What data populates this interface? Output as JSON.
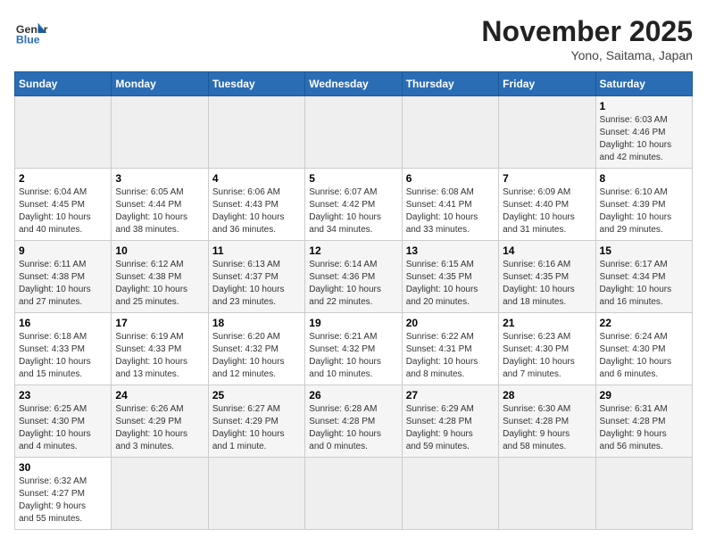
{
  "header": {
    "logo_general": "General",
    "logo_blue": "Blue",
    "month_title": "November 2025",
    "location": "Yono, Saitama, Japan"
  },
  "weekdays": [
    "Sunday",
    "Monday",
    "Tuesday",
    "Wednesday",
    "Thursday",
    "Friday",
    "Saturday"
  ],
  "weeks": [
    [
      {
        "day": "",
        "info": ""
      },
      {
        "day": "",
        "info": ""
      },
      {
        "day": "",
        "info": ""
      },
      {
        "day": "",
        "info": ""
      },
      {
        "day": "",
        "info": ""
      },
      {
        "day": "",
        "info": ""
      },
      {
        "day": "1",
        "info": "Sunrise: 6:03 AM\nSunset: 4:46 PM\nDaylight: 10 hours\nand 42 minutes."
      }
    ],
    [
      {
        "day": "2",
        "info": "Sunrise: 6:04 AM\nSunset: 4:45 PM\nDaylight: 10 hours\nand 40 minutes."
      },
      {
        "day": "3",
        "info": "Sunrise: 6:05 AM\nSunset: 4:44 PM\nDaylight: 10 hours\nand 38 minutes."
      },
      {
        "day": "4",
        "info": "Sunrise: 6:06 AM\nSunset: 4:43 PM\nDaylight: 10 hours\nand 36 minutes."
      },
      {
        "day": "5",
        "info": "Sunrise: 6:07 AM\nSunset: 4:42 PM\nDaylight: 10 hours\nand 34 minutes."
      },
      {
        "day": "6",
        "info": "Sunrise: 6:08 AM\nSunset: 4:41 PM\nDaylight: 10 hours\nand 33 minutes."
      },
      {
        "day": "7",
        "info": "Sunrise: 6:09 AM\nSunset: 4:40 PM\nDaylight: 10 hours\nand 31 minutes."
      },
      {
        "day": "8",
        "info": "Sunrise: 6:10 AM\nSunset: 4:39 PM\nDaylight: 10 hours\nand 29 minutes."
      }
    ],
    [
      {
        "day": "9",
        "info": "Sunrise: 6:11 AM\nSunset: 4:38 PM\nDaylight: 10 hours\nand 27 minutes."
      },
      {
        "day": "10",
        "info": "Sunrise: 6:12 AM\nSunset: 4:38 PM\nDaylight: 10 hours\nand 25 minutes."
      },
      {
        "day": "11",
        "info": "Sunrise: 6:13 AM\nSunset: 4:37 PM\nDaylight: 10 hours\nand 23 minutes."
      },
      {
        "day": "12",
        "info": "Sunrise: 6:14 AM\nSunset: 4:36 PM\nDaylight: 10 hours\nand 22 minutes."
      },
      {
        "day": "13",
        "info": "Sunrise: 6:15 AM\nSunset: 4:35 PM\nDaylight: 10 hours\nand 20 minutes."
      },
      {
        "day": "14",
        "info": "Sunrise: 6:16 AM\nSunset: 4:35 PM\nDaylight: 10 hours\nand 18 minutes."
      },
      {
        "day": "15",
        "info": "Sunrise: 6:17 AM\nSunset: 4:34 PM\nDaylight: 10 hours\nand 16 minutes."
      }
    ],
    [
      {
        "day": "16",
        "info": "Sunrise: 6:18 AM\nSunset: 4:33 PM\nDaylight: 10 hours\nand 15 minutes."
      },
      {
        "day": "17",
        "info": "Sunrise: 6:19 AM\nSunset: 4:33 PM\nDaylight: 10 hours\nand 13 minutes."
      },
      {
        "day": "18",
        "info": "Sunrise: 6:20 AM\nSunset: 4:32 PM\nDaylight: 10 hours\nand 12 minutes."
      },
      {
        "day": "19",
        "info": "Sunrise: 6:21 AM\nSunset: 4:32 PM\nDaylight: 10 hours\nand 10 minutes."
      },
      {
        "day": "20",
        "info": "Sunrise: 6:22 AM\nSunset: 4:31 PM\nDaylight: 10 hours\nand 8 minutes."
      },
      {
        "day": "21",
        "info": "Sunrise: 6:23 AM\nSunset: 4:30 PM\nDaylight: 10 hours\nand 7 minutes."
      },
      {
        "day": "22",
        "info": "Sunrise: 6:24 AM\nSunset: 4:30 PM\nDaylight: 10 hours\nand 6 minutes."
      }
    ],
    [
      {
        "day": "23",
        "info": "Sunrise: 6:25 AM\nSunset: 4:30 PM\nDaylight: 10 hours\nand 4 minutes."
      },
      {
        "day": "24",
        "info": "Sunrise: 6:26 AM\nSunset: 4:29 PM\nDaylight: 10 hours\nand 3 minutes."
      },
      {
        "day": "25",
        "info": "Sunrise: 6:27 AM\nSunset: 4:29 PM\nDaylight: 10 hours\nand 1 minute."
      },
      {
        "day": "26",
        "info": "Sunrise: 6:28 AM\nSunset: 4:28 PM\nDaylight: 10 hours\nand 0 minutes."
      },
      {
        "day": "27",
        "info": "Sunrise: 6:29 AM\nSunset: 4:28 PM\nDaylight: 9 hours\nand 59 minutes."
      },
      {
        "day": "28",
        "info": "Sunrise: 6:30 AM\nSunset: 4:28 PM\nDaylight: 9 hours\nand 58 minutes."
      },
      {
        "day": "29",
        "info": "Sunrise: 6:31 AM\nSunset: 4:28 PM\nDaylight: 9 hours\nand 56 minutes."
      }
    ],
    [
      {
        "day": "30",
        "info": "Sunrise: 6:32 AM\nSunset: 4:27 PM\nDaylight: 9 hours\nand 55 minutes."
      },
      {
        "day": "",
        "info": ""
      },
      {
        "day": "",
        "info": ""
      },
      {
        "day": "",
        "info": ""
      },
      {
        "day": "",
        "info": ""
      },
      {
        "day": "",
        "info": ""
      },
      {
        "day": "",
        "info": ""
      }
    ]
  ]
}
